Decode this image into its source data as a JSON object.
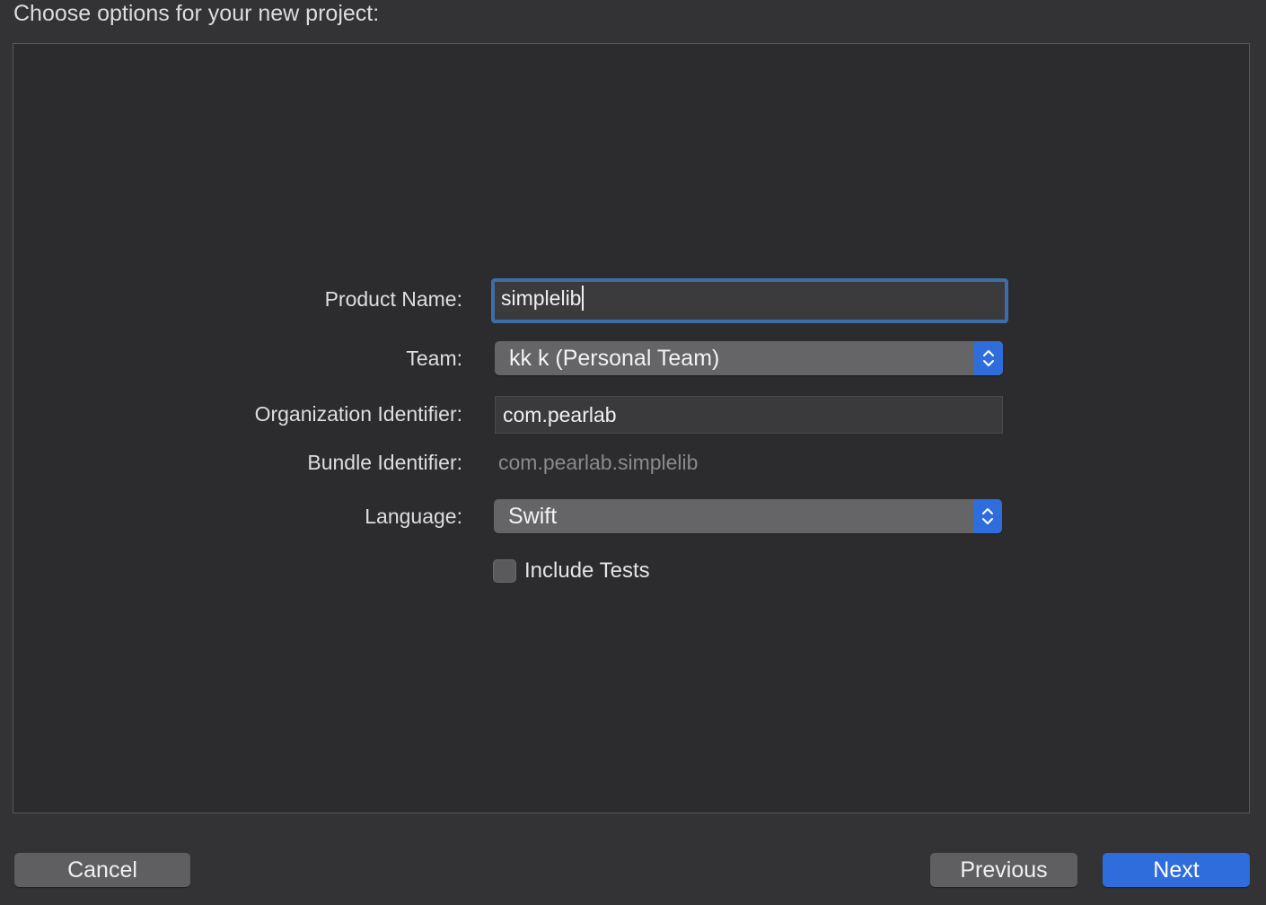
{
  "dialog": {
    "heading": "Choose options for your new project:"
  },
  "form": {
    "product_name": {
      "label": "Product Name:",
      "value": "simplelib"
    },
    "team": {
      "label": "Team:",
      "selected": "kk k (Personal Team)"
    },
    "organization_identifier": {
      "label": "Organization Identifier:",
      "value": "com.pearlab"
    },
    "bundle_identifier": {
      "label": "Bundle Identifier:",
      "value": "com.pearlab.simplelib"
    },
    "language": {
      "label": "Language:",
      "selected": "Swift"
    },
    "include_tests": {
      "label": "Include Tests",
      "checked": false
    }
  },
  "buttons": {
    "cancel": "Cancel",
    "previous": "Previous",
    "next": "Next"
  },
  "colors": {
    "background": "#333336",
    "panel": "#2c2c2e",
    "accent": "#2f6ddc",
    "focus_ring": "#3d6ea8"
  },
  "icons": {
    "popup_stepper": "chevron-up-down-icon"
  }
}
